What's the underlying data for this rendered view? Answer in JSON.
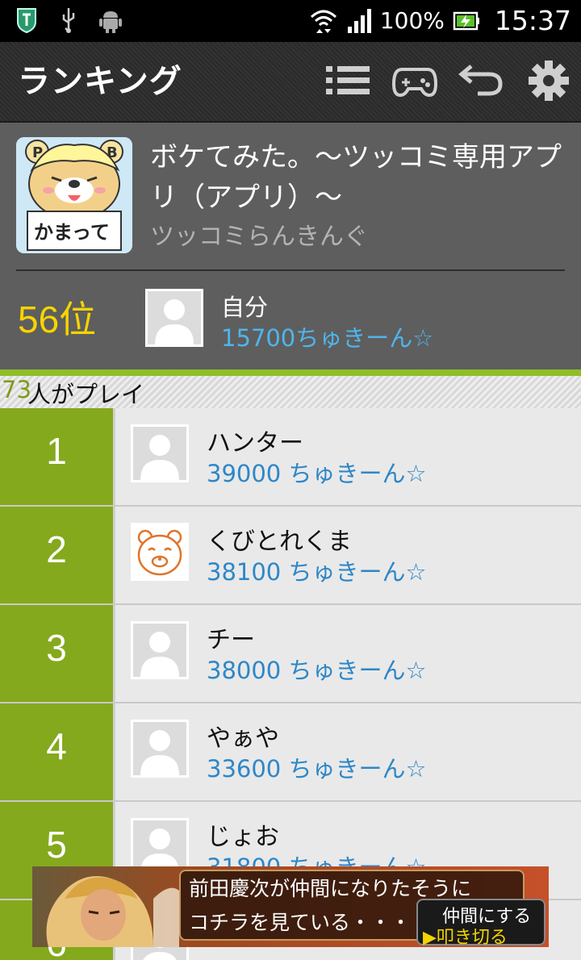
{
  "status_bar": {
    "battery": "100%",
    "time": "15:37"
  },
  "action_bar": {
    "title": "ランキング",
    "icons": [
      "list-icon",
      "gamepad-icon",
      "back-icon",
      "settings-icon"
    ]
  },
  "app": {
    "title": "ボケてみた。～ツッコミ専用アプリ（アプリ）～",
    "subtitle": "ツッコミらんきんぐ",
    "icon_text": "かまって",
    "icon_letters": [
      "P",
      "B"
    ]
  },
  "me": {
    "rank": "56位",
    "name": "自分",
    "score": "15700ちゅきーん☆"
  },
  "players": {
    "count": "73",
    "label": "人がプレイ"
  },
  "ranking": [
    {
      "rank": "1",
      "name": "ハンター",
      "score": "39000 ちゅきーん☆",
      "avatar": "default-avatar"
    },
    {
      "rank": "2",
      "name": "くびとれくま",
      "score": "38100 ちゅきーん☆",
      "avatar": "bear-avatar"
    },
    {
      "rank": "3",
      "name": "チー",
      "score": "38000 ちゅきーん☆",
      "avatar": "default-avatar"
    },
    {
      "rank": "4",
      "name": "やぁや",
      "score": "33600 ちゅきーん☆",
      "avatar": "default-avatar"
    },
    {
      "rank": "5",
      "name": "じょお",
      "score": "31800 ちゅきーん☆",
      "avatar": "default-avatar"
    },
    {
      "rank": "6",
      "name": "",
      "score": "",
      "avatar": "default-avatar"
    }
  ],
  "ad": {
    "line1": "前田慶次が仲間になりたそうに",
    "line2": "コチラを見ている・・・",
    "cta_top": "仲間にする",
    "cta_bottom": "▶叩き切る"
  },
  "colors": {
    "rank_column": "#84a91d",
    "score_blue": "#2d87c8",
    "my_rank_yellow": "#f5d400",
    "accent_green": "#8fbe27"
  }
}
